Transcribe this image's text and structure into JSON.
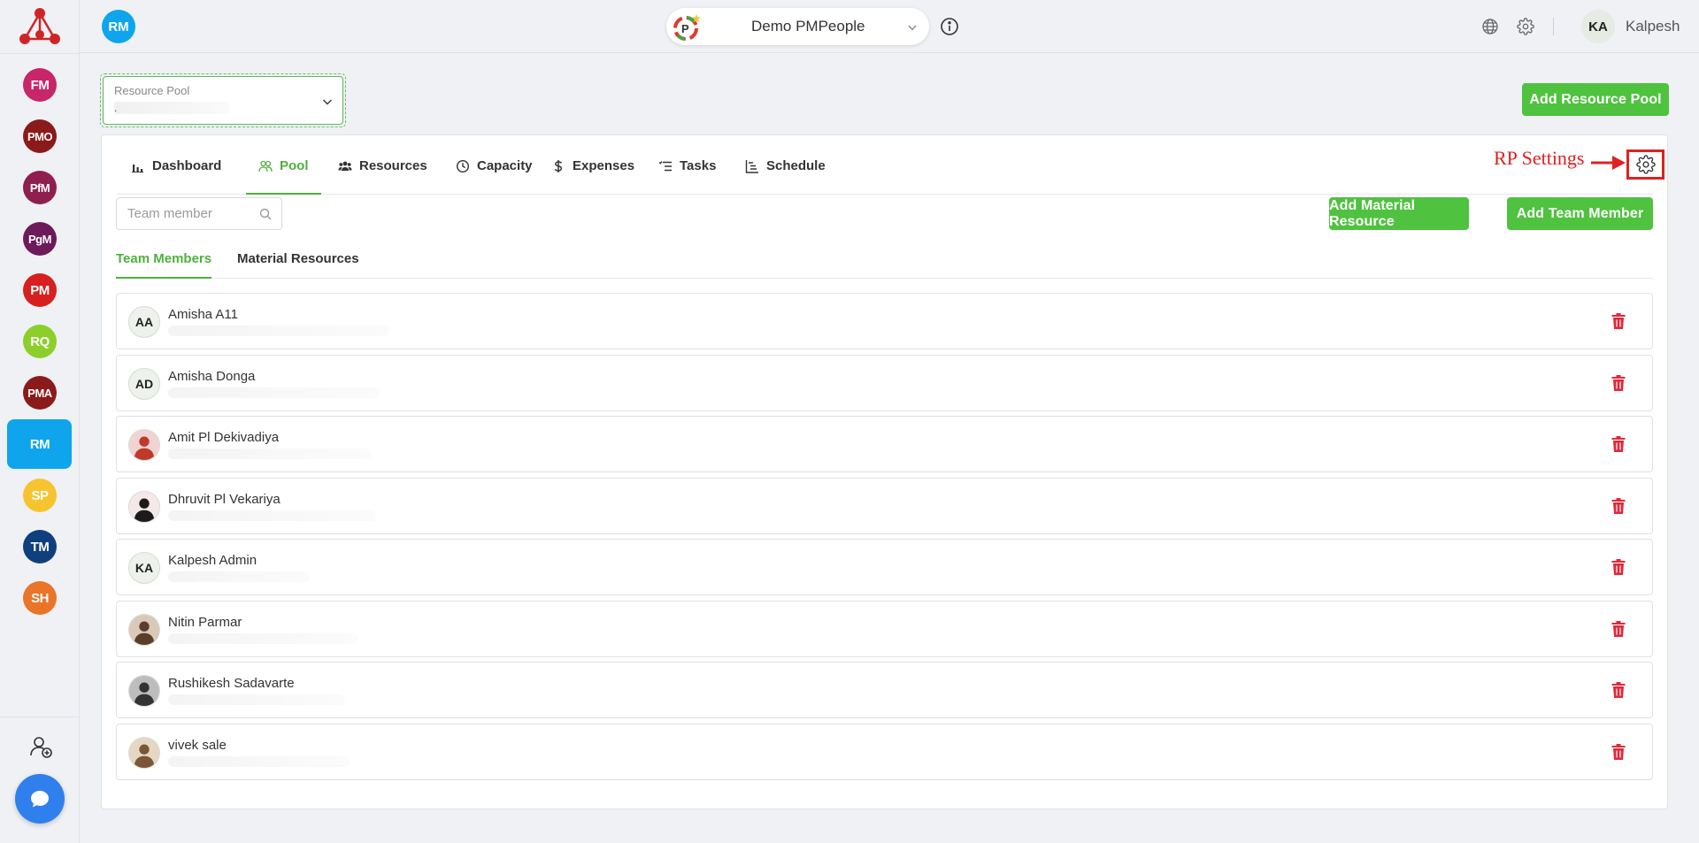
{
  "rail": {
    "apps": [
      {
        "label": "FM",
        "color": "#c72668"
      },
      {
        "label": "PMO",
        "color": "#8b1a1a"
      },
      {
        "label": "PfM",
        "color": "#8e1f4e"
      },
      {
        "label": "PgM",
        "color": "#6d1a5a"
      },
      {
        "label": "PM",
        "color": "#d71f1f"
      },
      {
        "label": "RQ",
        "color": "#8ccf2a"
      },
      {
        "label": "PMA",
        "color": "#8b1a1a"
      },
      {
        "label": "RM",
        "color": "#0ea5ec"
      },
      {
        "label": "SP",
        "color": "#f6c431"
      },
      {
        "label": "TM",
        "color": "#0f3f7d"
      },
      {
        "label": "SH",
        "color": "#ea7427"
      }
    ]
  },
  "topbar": {
    "module_badge": "RM",
    "workspace_name": "Demo PMPeople",
    "user_initials": "KA",
    "user_name": "Kalpesh"
  },
  "pool_select": {
    "label": "Resource Pool",
    "value": "."
  },
  "add_resource_pool_label": "Add Resource Pool",
  "tabs": [
    {
      "label": "Dashboard",
      "icon": "bar-chart-icon"
    },
    {
      "label": "Pool",
      "icon": "users-icon",
      "active": true
    },
    {
      "label": "Resources",
      "icon": "group-icon"
    },
    {
      "label": "Capacity",
      "icon": "clock-icon"
    },
    {
      "label": "Expenses",
      "icon": "dollar-icon"
    },
    {
      "label": "Tasks",
      "icon": "list-icon"
    },
    {
      "label": "Schedule",
      "icon": "gantt-icon"
    }
  ],
  "annotation": {
    "label": "RP Settings",
    "color": "#e02020"
  },
  "search": {
    "placeholder": "Team member"
  },
  "buttons": {
    "add_material": "Add Material Resource",
    "add_member": "Add Team Member"
  },
  "subtabs": [
    {
      "label": "Team Members",
      "active": true
    },
    {
      "label": "Material Resources"
    }
  ],
  "members": [
    {
      "name": "Amisha A11",
      "initials": "AA",
      "photo": false
    },
    {
      "name": "Amisha Donga",
      "initials": "AD",
      "photo": false
    },
    {
      "name": "Amit Pl Dekivadiya",
      "initials": "",
      "photo": true
    },
    {
      "name": "Dhruvit Pl Vekariya",
      "initials": "",
      "photo": true
    },
    {
      "name": "Kalpesh Admin",
      "initials": "KA",
      "photo": false
    },
    {
      "name": "Nitin Parmar",
      "initials": "",
      "photo": true
    },
    {
      "name": "Rushikesh Sadavarte",
      "initials": "",
      "photo": true
    },
    {
      "name": "vivek sale",
      "initials": "",
      "photo": true
    }
  ],
  "colors": {
    "accent_green": "#4fc23f",
    "active_blue": "#0ea5ec",
    "delete_red": "#e0283a"
  }
}
